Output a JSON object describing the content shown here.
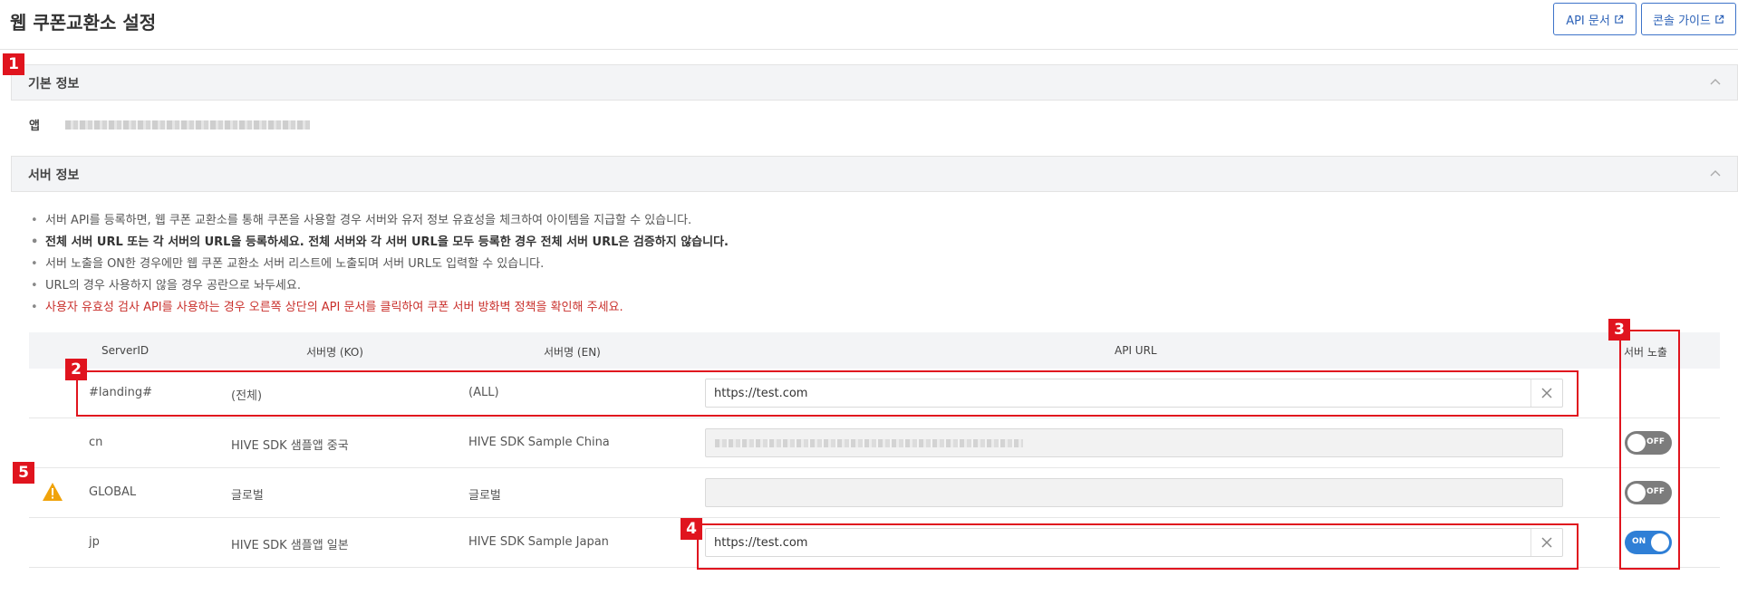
{
  "page": {
    "title": "웹 쿠폰교환소 설정"
  },
  "top_buttons": {
    "api_doc": "API 문서",
    "console_guide": "콘솔 가이드"
  },
  "basic_info": {
    "title": "기본 정보",
    "app_label": "앱"
  },
  "server_info": {
    "title": "서버 정보",
    "notes": [
      "서버 API를 등록하면, 웹 쿠폰 교환소를 통해 쿠폰을 사용할 경우 서버와 유저 정보 유효성을 체크하여 아이템을 지급할 수 있습니다.",
      "전체 서버 URL 또는 각 서버의 URL을 등록하세요. 전체 서버와 각 서버 URL을 모두 등록한 경우 전체 서버 URL은 검증하지 않습니다.",
      "서버 노출을 ON한 경우에만 웹 쿠폰 교환소 서버 리스트에 노출되며 서버 URL도 입력할 수 있습니다.",
      "URL의 경우 사용하지 않을 경우 공란으로 놔두세요.",
      "사용자 유효성 검사 API를 사용하는 경우 오른쪽 상단의 API 문서를 클릭하여 쿠폰 서버 방화벽 정책을 확인해 주세요."
    ]
  },
  "table": {
    "headers": {
      "server_id": "ServerID",
      "name_ko": "서버명 (KO)",
      "name_en": "서버명 (EN)",
      "api_url": "API URL",
      "exposure": "서버 노출"
    },
    "rows": [
      {
        "server_id": "#landing#",
        "name_ko": "(전체)",
        "name_en": "(ALL)",
        "api_url": "https://test.com",
        "toggle": null
      },
      {
        "server_id": "cn",
        "name_ko": "HIVE SDK 샘플앱 중국",
        "name_en": "HIVE SDK Sample China",
        "api_url": "",
        "toggle": "OFF"
      },
      {
        "server_id": "GLOBAL",
        "name_ko": "글로벌",
        "name_en": "글로벌",
        "api_url": "",
        "toggle": "OFF"
      },
      {
        "server_id": "jp",
        "name_ko": "HIVE SDK 샘플앱 일본",
        "name_en": "HIVE SDK Sample Japan",
        "api_url": "https://test.com",
        "toggle": "ON"
      }
    ]
  },
  "badges": [
    "1",
    "2",
    "3",
    "4",
    "5"
  ],
  "colors": {
    "accent": "#2f7fd6",
    "annotation": "#e0141e",
    "warning": "#f0a30a",
    "note_red": "#c9302c"
  }
}
